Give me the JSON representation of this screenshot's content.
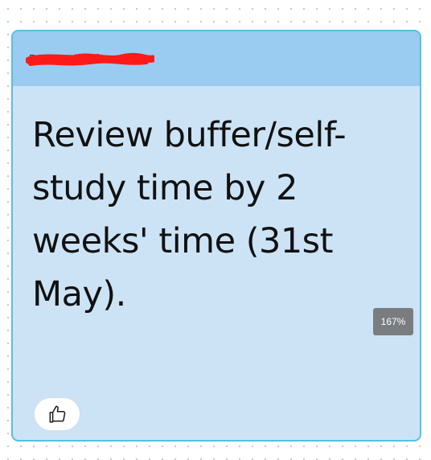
{
  "note": {
    "author": "Redacted name",
    "text": "Review buffer/self-study time by 2 weeks' time (31st May).",
    "zoom": "167%",
    "colors": {
      "header": "#9acbf0",
      "body": "#cce3f6",
      "border": "#57c0e0",
      "redaction": "#ff1a1a"
    },
    "icons": {
      "like": "thumbs-up-icon"
    }
  }
}
